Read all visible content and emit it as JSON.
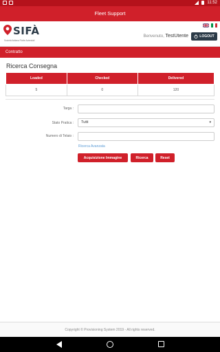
{
  "status_bar": {
    "time": "11:52"
  },
  "app_bar": {
    "title": "Fleet Support"
  },
  "header": {
    "logo_text": "SIFÀ",
    "logo_subtitle": "Società Italiana Flotte Aziendali",
    "welcome_label": "Benvenuto,",
    "username": "TestUtente",
    "logout_label": "LOGOUT"
  },
  "nav": {
    "items": [
      {
        "label": "Contratto"
      }
    ]
  },
  "main": {
    "title": "Ricerca Consegna",
    "summary": {
      "headers": [
        "Loaded",
        "Checked",
        "Delivered"
      ],
      "values": [
        "5",
        "0",
        "120"
      ]
    },
    "form": {
      "targa": {
        "label": "Targa :",
        "value": ""
      },
      "stato_pratica": {
        "label": "Stato Pratica :",
        "value": "Tutti"
      },
      "numero_telaio": {
        "label": "Numero di Telaio :",
        "value": ""
      },
      "advanced_link": "Ricerca Avanzata"
    },
    "buttons": {
      "acquisizione": "Acquisizione Immagine",
      "ricerca": "Ricerca",
      "reset": "Reset"
    }
  },
  "footer": {
    "copyright": "Copyright © Provisioning System 2019 - All rights reserved."
  },
  "colors": {
    "brand_red": "#d0202a",
    "status_red": "#b5121b",
    "dark_navy": "#2b3a47",
    "link_blue": "#5b9bd5"
  },
  "icons": [
    "location-pin-icon",
    "uk-flag-icon",
    "italy-flag-icon",
    "logout-icon",
    "back-icon",
    "home-icon",
    "recents-icon",
    "wifi-icon",
    "battery-icon"
  ]
}
